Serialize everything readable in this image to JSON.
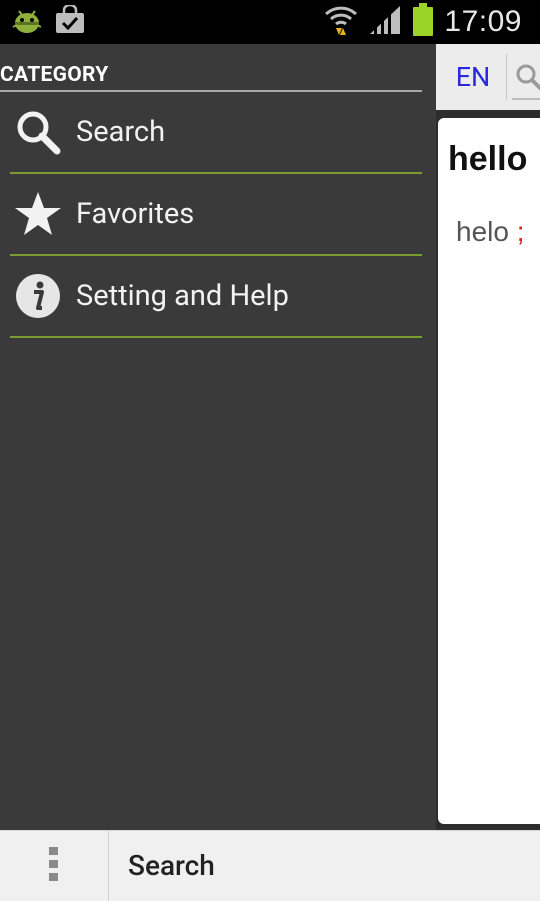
{
  "status_bar": {
    "time": "17:09",
    "icons": [
      "android-debug-icon",
      "shopping-bag-icon",
      "wifi-icon",
      "signal-icon",
      "battery-icon"
    ]
  },
  "drawer": {
    "header": "CATEGORY",
    "items": [
      {
        "label": "Search",
        "icon": "search-icon"
      },
      {
        "label": "Favorites",
        "icon": "star-icon"
      },
      {
        "label": "Setting and Help",
        "icon": "info-icon"
      }
    ],
    "divider_color": "#7a9c2f"
  },
  "content": {
    "language": "EN",
    "word": "hello",
    "definition": "helo",
    "separator": ";"
  },
  "bottom_bar": {
    "title": "Search"
  },
  "colors": {
    "drawer_bg": "#3a3a3a",
    "accent_green": "#7a9c2f",
    "link_blue": "#2a2adc",
    "separator_red": "#e41b1b"
  }
}
